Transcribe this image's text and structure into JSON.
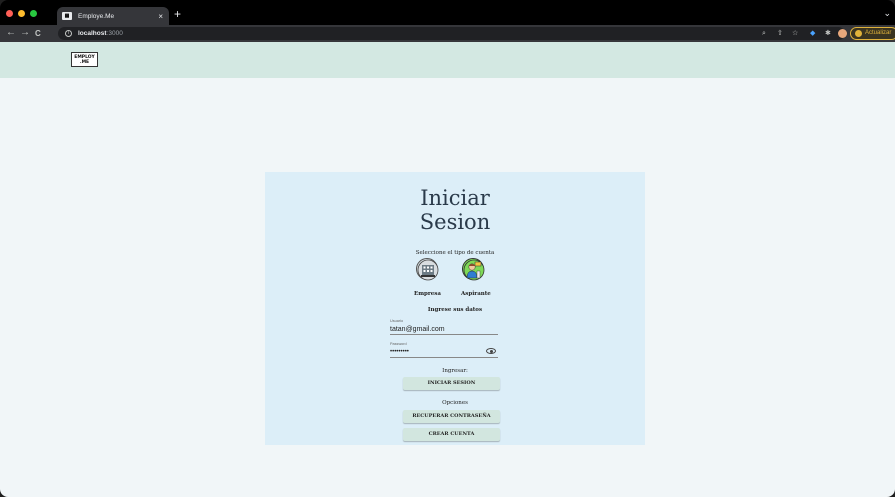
{
  "browser": {
    "tab_title": "Employe.Me",
    "tab_close": "×",
    "new_tab": "+",
    "url_host": "localhost",
    "url_port": ":3000",
    "update_label": "Actualizar",
    "nav_back": "←",
    "nav_forward": "→",
    "nav_reload": "C",
    "traffic_colors": [
      "#ff5f57",
      "#febc2e",
      "#28c840"
    ]
  },
  "app": {
    "logo_line1": "EMPLOY",
    "logo_line2": ".ME"
  },
  "login": {
    "title_line1": "Iniciar",
    "title_line2": "Sesion",
    "account_type_prompt": "Seleccione el tipo de cuenta",
    "account_types": [
      {
        "label": "Empresa",
        "icon": "building-icon"
      },
      {
        "label": "Aspirante",
        "icon": "person-icon"
      }
    ],
    "data_prompt": "Ingrese sus datos",
    "user_label": "Usuario",
    "user_value": "tatan@gmail.com",
    "password_label": "Password",
    "password_value": "•••••••••",
    "login_section": "Ingresar:",
    "login_button": "INICIAR SESION",
    "options_section": "Opciones",
    "recover_button": "RECUPERAR CONTRASEÑA",
    "create_button": "CREAR CUENTA"
  },
  "colors": {
    "appbar": "#d3e8e2",
    "card": "#dceef8",
    "button": "#d2e6df"
  }
}
